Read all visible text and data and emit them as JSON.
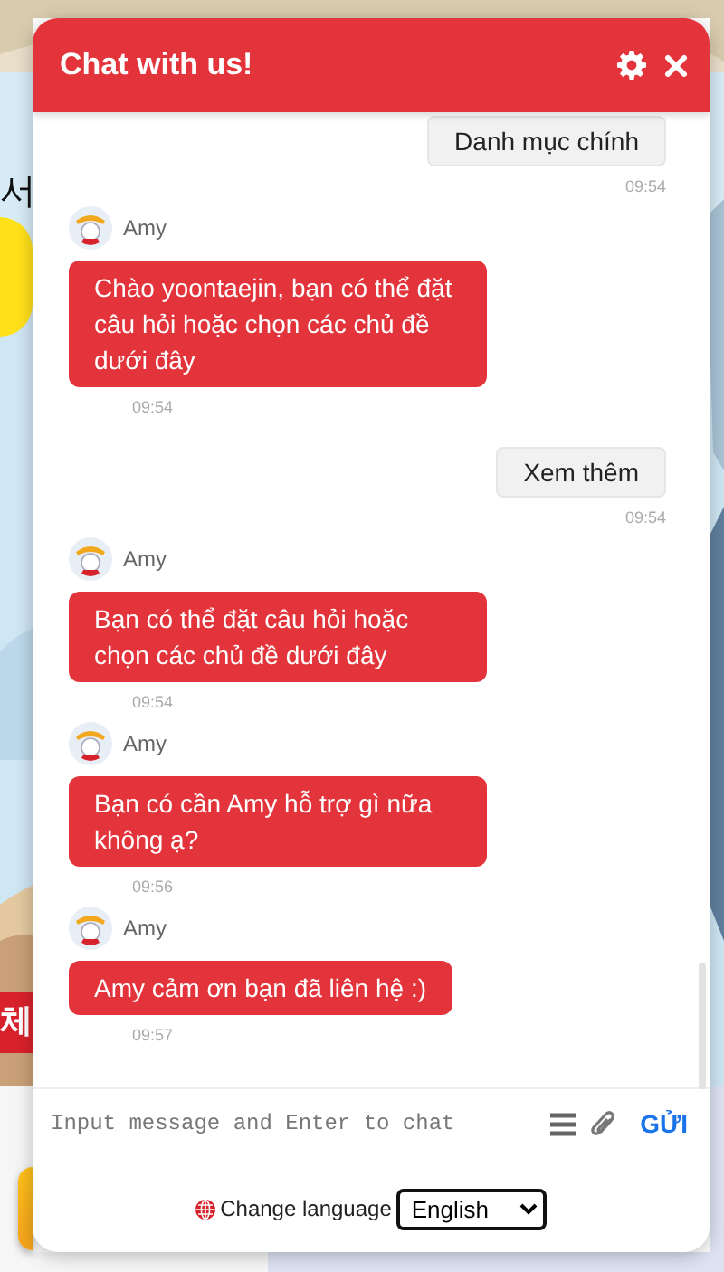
{
  "background": {
    "heading_fragment": "서",
    "tag_fragment": "체"
  },
  "header": {
    "title": "Chat with us!"
  },
  "messages": [
    {
      "kind": "option",
      "text": "Danh mục chính",
      "time": "09:54"
    },
    {
      "kind": "bot",
      "sender": "Amy",
      "text": "Chào yoontaejin, bạn có thể đặt câu hỏi hoặc chọn các chủ đề dưới đây",
      "time": "09:54"
    },
    {
      "kind": "option",
      "text": "Xem thêm",
      "time": "09:54"
    },
    {
      "kind": "bot",
      "sender": "Amy",
      "text": "Bạn có thể đặt câu hỏi hoặc chọn các chủ đề dưới đây",
      "time": "09:54"
    },
    {
      "kind": "bot",
      "sender": "Amy",
      "text": "Bạn có cần Amy hỗ trợ gì nữa không ạ?",
      "time": "09:56"
    },
    {
      "kind": "bot",
      "sender": "Amy",
      "text": "Amy cảm ơn bạn đã liên hệ :)",
      "time": "09:57"
    }
  ],
  "composer": {
    "placeholder": "Input message and Enter to chat",
    "send": "GỬI"
  },
  "footer": {
    "label": "Change language",
    "language": "English"
  }
}
